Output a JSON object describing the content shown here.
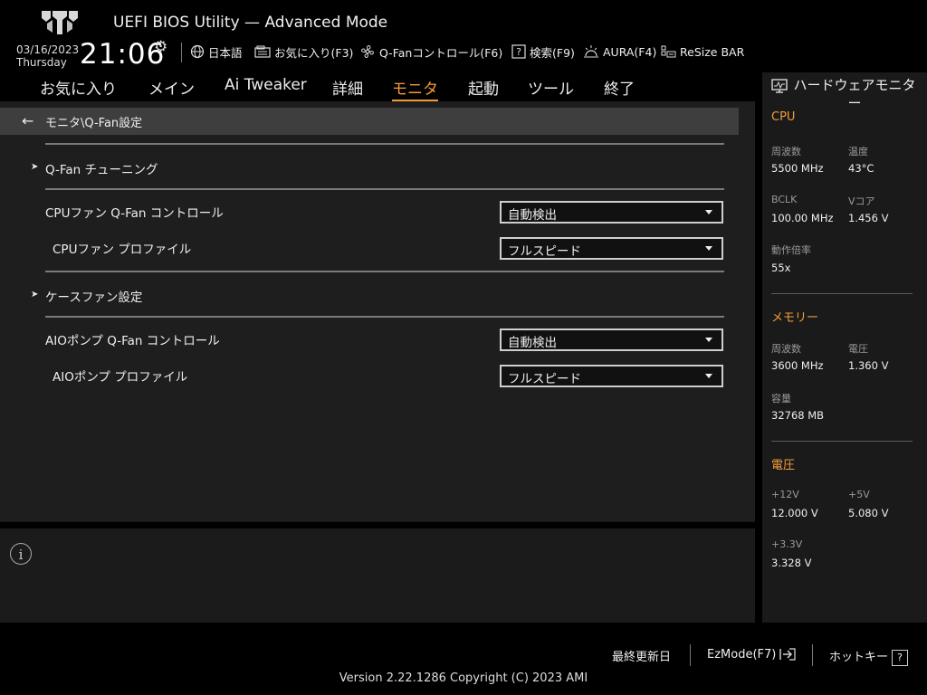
{
  "header": {
    "title": "UEFI BIOS Utility — Advanced Mode",
    "date": "03/16/2023",
    "day": "Thursday",
    "time": "21:06",
    "tools": {
      "language": "日本語",
      "favorites": "お気に入り(F3)",
      "qfan": "Q-Fanコントロール(F6)",
      "search": "検索(F9)",
      "aura": "AURA(F4)",
      "resize_bar": "ReSize BAR"
    }
  },
  "menu": {
    "items": [
      "お気に入り",
      "メイン",
      "Ai Tweaker",
      "詳細",
      "モニタ",
      "起動",
      "ツール",
      "終了"
    ],
    "active": "モニタ"
  },
  "breadcrumb": "モニタ\\Q-Fan設定",
  "settings": {
    "qfan_tuning": "Q-Fan チューニング",
    "cpu_fan_control_label": "CPUファン Q-Fan コントロール",
    "cpu_fan_control_value": "自動検出",
    "cpu_fan_profile_label": "CPUファン プロファイル",
    "cpu_fan_profile_value": "フルスピード",
    "case_fan": "ケースファン設定",
    "aio_pump_control_label": "AIOポンプ Q-Fan コントロール",
    "aio_pump_control_value": "自動検出",
    "aio_pump_profile_label": "AIOポンプ プロファイル",
    "aio_pump_profile_value": "フルスピード"
  },
  "hardware_monitor": {
    "title": "ハードウェアモニター",
    "cpu": {
      "title": "CPU",
      "freq_label": "周波数",
      "freq_value": "5500 MHz",
      "temp_label": "温度",
      "temp_value": "43°C",
      "bclk_label": "BCLK",
      "bclk_value": "100.00 MHz",
      "vcore_label": "Vコア",
      "vcore_value": "1.456 V",
      "ratio_label": "動作倍率",
      "ratio_value": "55x"
    },
    "memory": {
      "title": "メモリー",
      "freq_label": "周波数",
      "freq_value": "3600 MHz",
      "volt_label": "電圧",
      "volt_value": "1.360 V",
      "cap_label": "容量",
      "cap_value": "32768 MB"
    },
    "voltage": {
      "title": "電圧",
      "v12_label": "+12V",
      "v12_value": "12.000 V",
      "v5_label": "+5V",
      "v5_value": "5.080 V",
      "v33_label": "+3.3V",
      "v33_value": "3.328 V"
    }
  },
  "footer": {
    "last_modified": "最終更新日",
    "ezmode": "EzMode(F7)",
    "hotkeys": "ホットキー",
    "hotkeys_key": "?",
    "version": "Version 2.22.1286 Copyright (C) 2023 AMI"
  },
  "colors": {
    "accent": "#f39b3a",
    "background": "#1e1e1e",
    "breadcrumb_bar": "#3e3e3e"
  }
}
